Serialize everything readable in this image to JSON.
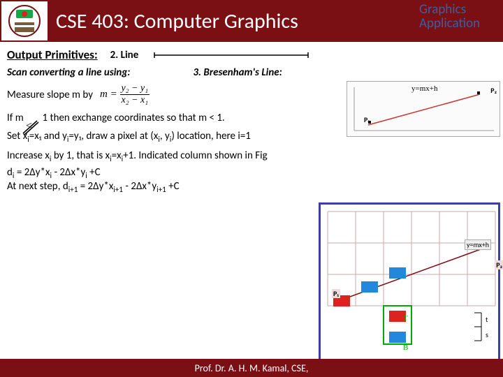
{
  "header": {
    "title": "CSE 403: Computer Graphics",
    "top_tag1": "Graphics",
    "top_tag2": "Application"
  },
  "body": {
    "out_prim": "Output Primitives:",
    "line_label": "2. Line",
    "scan": "Scan converting a line using:",
    "bres": "3. Bresenham's Line:",
    "measure": "Measure slope m by",
    "formula_m": "m =",
    "formula_num": "y₂ − y₁",
    "formula_den": "x₂ − x₁",
    "ifm_pre": "If m",
    "ifm_post": "1  then exchange coordinates so that m < 1.",
    "set_line": "Set x",
    "set_line_rest": "=x₁ and y",
    "set_line_rest2": "=y₁, draw a pixel at (x",
    "set_line_rest3": ", y",
    "set_line_rest4": ") location, here i=1",
    "inc_line_a": "Increase x",
    "inc_line_b": " by 1, that is x",
    "inc_line_c": "=x",
    "inc_line_d": "+1. Indicated column shown in Fig",
    "d_line1a": "d",
    "d_line1b": " = 2Δy*x",
    "d_line1c": " - 2Δx*y",
    "d_line1d": " +C",
    "d_line2a": "At next step, d",
    "d_line2b": " = 2Δy*x",
    "d_line2c": " - 2Δx*y",
    "d_line2d": " +C"
  },
  "figs": {
    "ymxh": "y=mx+h",
    "p1": "P₁",
    "p2": "P₂",
    "T": "T",
    "B": "B",
    "t": "t",
    "s": "s"
  },
  "footer": "Prof. Dr. A. H. M. Kamal, CSE,"
}
